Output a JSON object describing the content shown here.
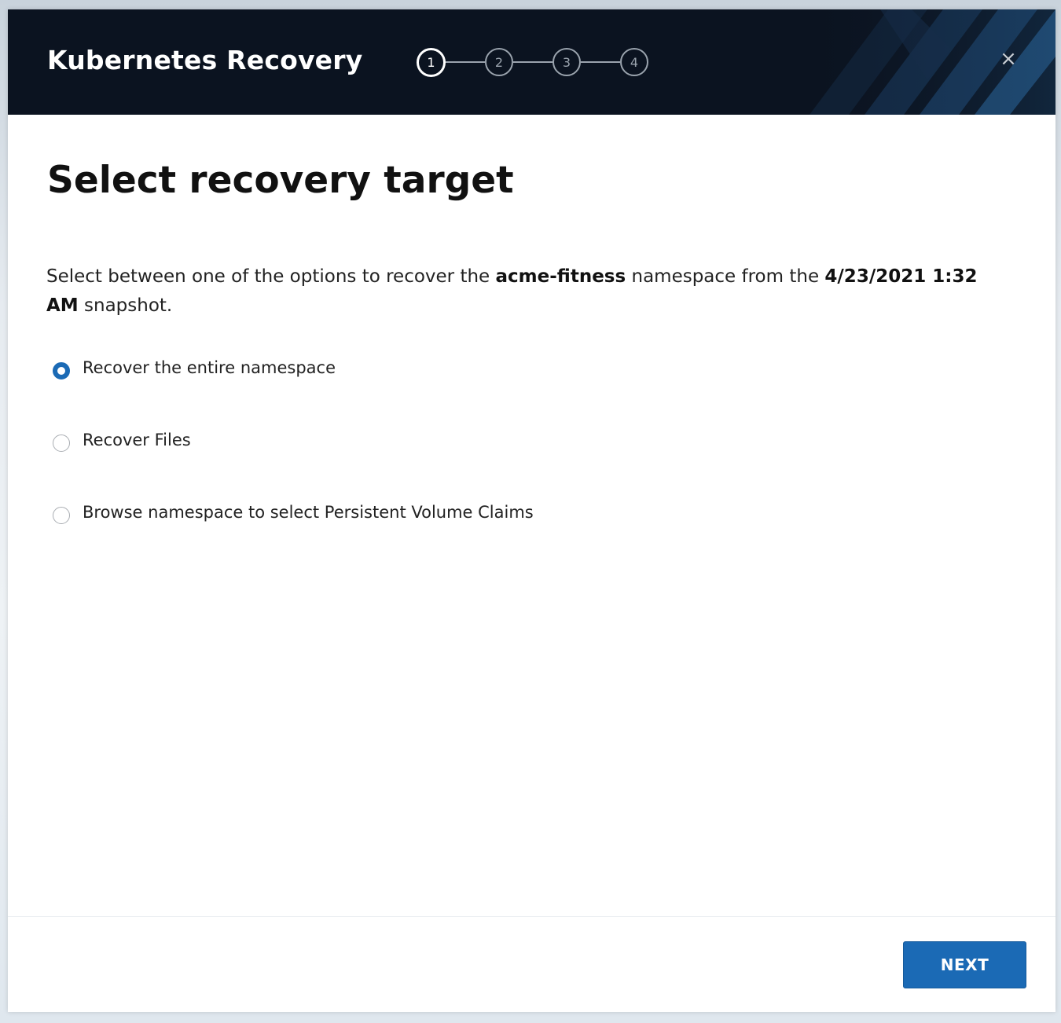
{
  "header": {
    "title": "Kubernetes Recovery",
    "steps": [
      "1",
      "2",
      "3",
      "4"
    ],
    "active_step": 1,
    "close_icon": "×"
  },
  "main": {
    "title": "Select recovery target",
    "description": {
      "prefix": "Select between one of the options to recover the ",
      "namespace": "acme-fitness",
      "middle": " namespace from the ",
      "snapshot_time": "4/23/2021 1:32 AM",
      "suffix": " snapshot."
    },
    "options": [
      {
        "label": "Recover the entire namespace",
        "checked": true
      },
      {
        "label": "Recover Files",
        "checked": false
      },
      {
        "label": "Browse namespace to select Persistent Volume Claims",
        "checked": false
      }
    ]
  },
  "footer": {
    "next_label": "NEXT"
  },
  "colors": {
    "header_bg": "#0b1320",
    "accent": "#1b6ab5"
  },
  "icons": {
    "close": "close-icon",
    "radio_selected": "radio-selected-icon",
    "radio_unselected": "radio-unselected-icon"
  }
}
